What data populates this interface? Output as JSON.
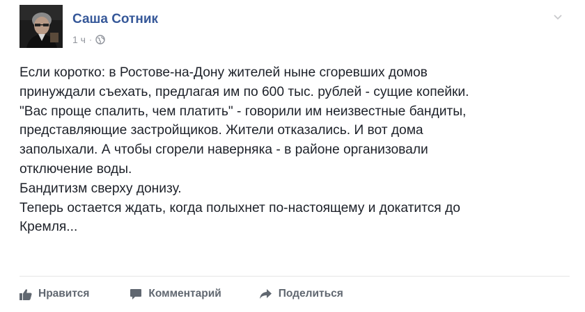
{
  "post": {
    "author": "Саша Сотник",
    "time": "1 ч",
    "separator": "·",
    "privacy_icon": "globe-icon",
    "menu_icon": "chevron-down-icon",
    "paragraphs": [
      "Если коротко: в Ростове-на-Дону жителей ныне сгоревших домов\nпринуждали съехать, предлагая им по 600 тыс. рублей - сущие копейки.\n\"Вас проще спалить, чем платить\" - говорили им неизвестные бандиты,\nпредставляющие застройщиков. Жители отказались. И вот дома\nзаполыхали. А чтобы сгорели наверняка - в районе организовали\nотключение воды.",
      "Бандитизм сверху донизу.",
      "Теперь остается ждать, когда полыхнет по-настоящему и докатится до\nКремля..."
    ]
  },
  "actions": {
    "like": {
      "label": "Нравится",
      "icon": "thumbs-up-icon"
    },
    "comment": {
      "label": "Комментарий",
      "icon": "comment-icon"
    },
    "share": {
      "label": "Поделиться",
      "icon": "share-icon"
    }
  },
  "colors": {
    "author_link": "#365899",
    "text": "#1d2129",
    "meta": "#90949c",
    "action": "#606770"
  }
}
